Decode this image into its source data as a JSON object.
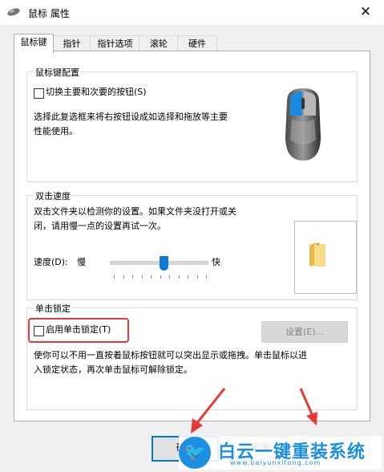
{
  "window": {
    "title": "鼠标 属性",
    "close_label": "✕"
  },
  "tabs": [
    "鼠标键",
    "指针",
    "指针选项",
    "滚轮",
    "硬件"
  ],
  "button_config": {
    "group_title": "鼠标键配置",
    "checkbox_label": "切换主要和次要的按钮(S)",
    "checkbox_checked": false,
    "description": "选择此复选框来将右按钮设成如选择和拖放等主要\n性能使用。"
  },
  "double_click": {
    "group_title": "双击速度",
    "description": "双击文件夹以检测你的设置。如果文件夹没打开或关\n闭，请用慢一点的设置再试一次。",
    "speed_label": "速度(D):",
    "slow_label": "慢",
    "fast_label": "快",
    "speed_fraction": 0.55
  },
  "click_lock": {
    "group_title": "单击锁定",
    "checkbox_label": "启用单击锁定(T)",
    "checkbox_checked": false,
    "settings_button": "设置(E)...",
    "description": "使你可以不用一直按着鼠标按钮就可以突出显示或拖拽。单击鼠标以进\n入锁定状态，再次单击鼠标可解除锁定。"
  },
  "dialog_buttons": {
    "ok": "确定",
    "cancel": "取消"
  },
  "watermark": {
    "logo_letter": "🐦",
    "title": "白云一键重装系统",
    "url": "www.baiyunxitong.com"
  },
  "colors": {
    "accent": "#0078d7",
    "highlight": "#e53935",
    "watermark": "#1d8fe0"
  }
}
